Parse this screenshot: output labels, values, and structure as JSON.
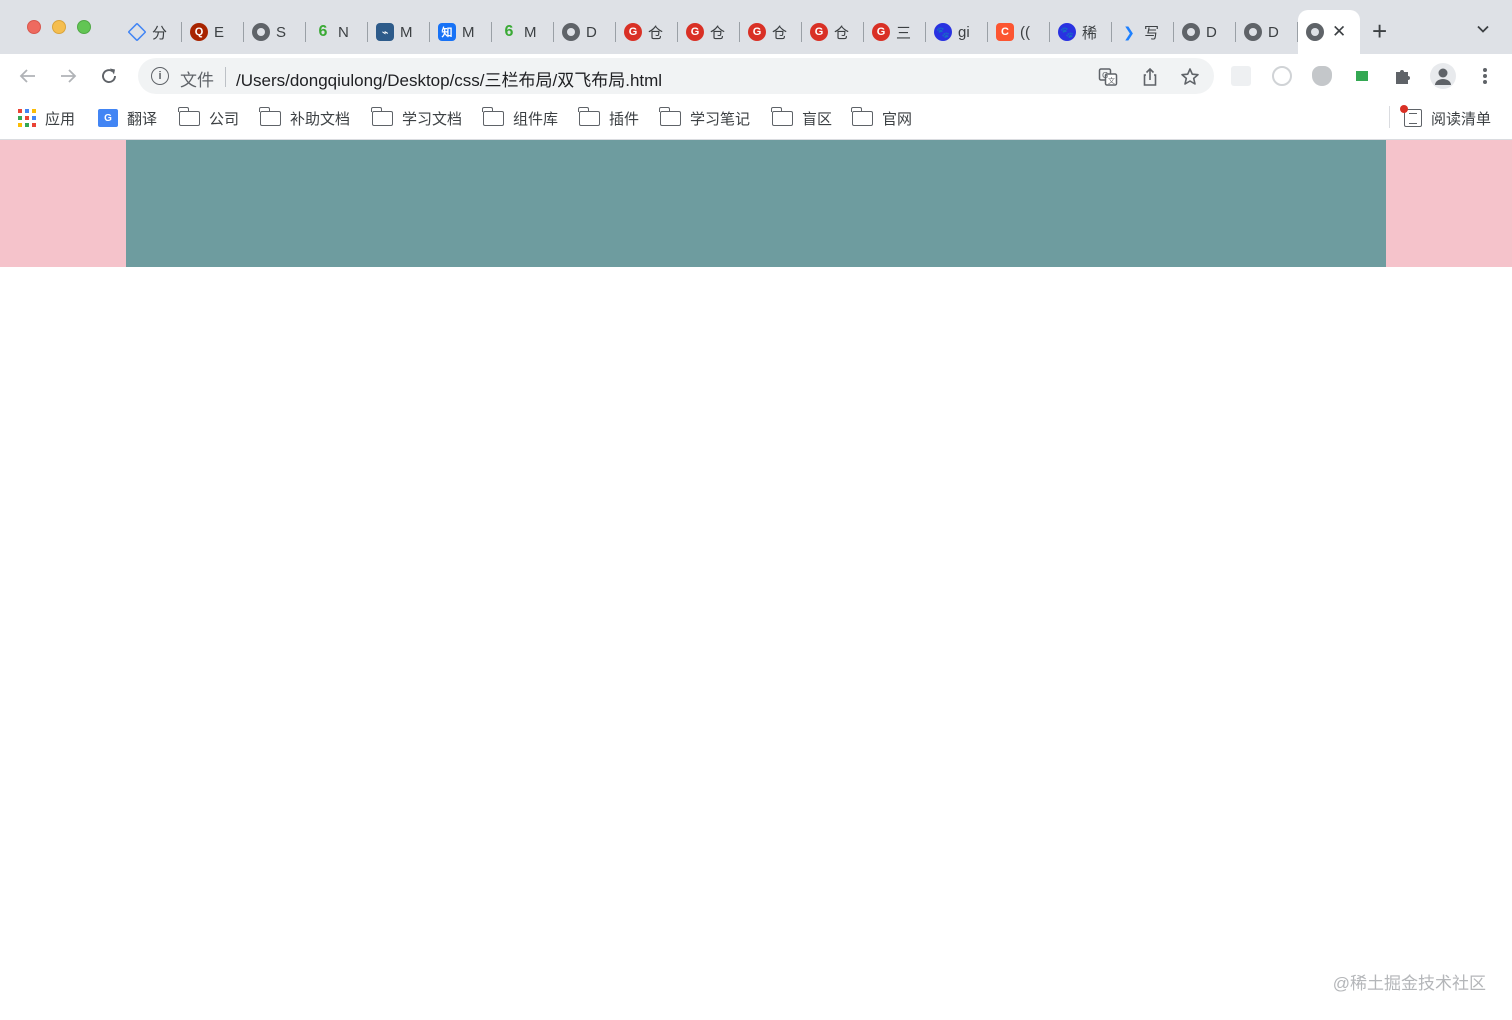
{
  "window": {
    "tabs": [
      {
        "icon": "diamond-icon",
        "title": "分"
      },
      {
        "icon": "quora-icon",
        "title": "E"
      },
      {
        "icon": "globe-icon",
        "title": "S"
      },
      {
        "icon": "es6-icon",
        "title": "N"
      },
      {
        "icon": "mysql-icon",
        "title": "M"
      },
      {
        "icon": "zhihu-icon",
        "title": "M"
      },
      {
        "icon": "es6-icon",
        "title": "M"
      },
      {
        "icon": "globe-icon",
        "title": "D"
      },
      {
        "icon": "g-red-icon",
        "title": "仓"
      },
      {
        "icon": "g-red-icon",
        "title": "仓"
      },
      {
        "icon": "g-red-icon",
        "title": "仓"
      },
      {
        "icon": "g-red-icon",
        "title": "仓"
      },
      {
        "icon": "g-red-icon",
        "title": "三"
      },
      {
        "icon": "baidu-icon",
        "title": "gi"
      },
      {
        "icon": "csdn-icon",
        "title": "(("
      },
      {
        "icon": "baidu-icon",
        "title": "稀"
      },
      {
        "icon": "juejin-icon",
        "title": "写"
      },
      {
        "icon": "globe-icon",
        "title": "D"
      },
      {
        "icon": "globe-icon",
        "title": "D"
      }
    ],
    "active_tab": {
      "icon": "globe-icon",
      "close": "✕"
    },
    "new_tab": "+"
  },
  "toolbar": {
    "scheme": "文件",
    "url": "/Users/dongqiulong/Desktop/css/三栏布局/双飞布局.html"
  },
  "bookmarks": {
    "apps": "应用",
    "translate": "翻译",
    "folders": [
      "公司",
      "补助文档",
      "学习文档",
      "组件库",
      "插件",
      "学习笔记",
      "盲区",
      "官网"
    ],
    "reading_list": "阅读清单"
  },
  "layout_demo": {
    "left_color": "#f5c3cb",
    "center_color": "#6e9c9f",
    "right_color": "#f5c3cb"
  },
  "watermark": "@稀土掘金技术社区"
}
